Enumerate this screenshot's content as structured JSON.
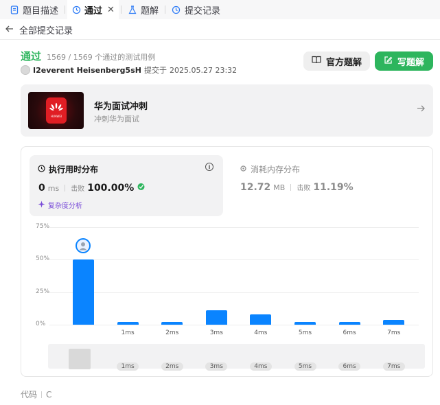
{
  "tabs": [
    {
      "label": "题目描述"
    },
    {
      "label": "通过"
    },
    {
      "label": "题解"
    },
    {
      "label": "提交记录"
    }
  ],
  "back": {
    "label": "全部提交记录"
  },
  "submission": {
    "status": "通过",
    "cases": "1569 / 1569 个通过的测试用例",
    "username": "I2everent Heisenberg5sH",
    "submitted_prefix": "提交于",
    "submitted_at": "2025.05.27 23:32"
  },
  "buttons": {
    "official": "官方题解",
    "write": "写题解"
  },
  "banner": {
    "title": "华为面试冲刺",
    "subtitle": "冲刺华为面试",
    "logo_text": "HUAWEI"
  },
  "runtime": {
    "title": "执行用时分布",
    "value": "0",
    "unit": "ms",
    "beat_label": "击败",
    "beat_value": "100.00%",
    "complexity": "复杂度分析"
  },
  "memory": {
    "title": "消耗内存分布",
    "value": "12.72",
    "unit": "MB",
    "beat_label": "击败",
    "beat_value": "11.19%"
  },
  "chart_data": {
    "type": "bar",
    "categories": [
      "0ms",
      "1ms",
      "2ms",
      "3ms",
      "4ms",
      "5ms",
      "6ms",
      "7ms"
    ],
    "x_labels": [
      "",
      "1ms",
      "2ms",
      "3ms",
      "4ms",
      "5ms",
      "6ms",
      "7ms"
    ],
    "values": [
      50,
      1.5,
      1.5,
      11,
      8,
      1.5,
      1.5,
      3.5
    ],
    "yticks": [
      "75%",
      "50%",
      "25%",
      "0%"
    ],
    "ylim": [
      0,
      75
    ],
    "colors": {
      "bar": "#0a84ff"
    }
  },
  "code": {
    "label": "代码",
    "language": "C"
  }
}
